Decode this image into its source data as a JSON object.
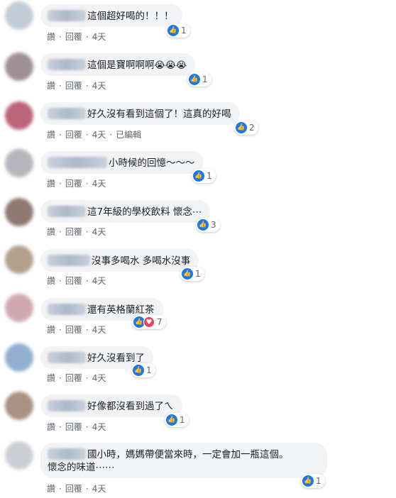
{
  "actions": {
    "like": "讚",
    "reply": "回覆",
    "separator": "·"
  },
  "comments": [
    {
      "text": "這個超好喝的！！！",
      "time": "4天",
      "reactions": "1"
    },
    {
      "text": "這個是寶啊啊啊",
      "emoji": "😭😭😭",
      "time": "4天",
      "reactions": "1"
    },
    {
      "text": "好久沒有看到這個了！這真的好喝",
      "time": "4天",
      "edited": "已編輯",
      "reactions": "2"
    },
    {
      "text": "小時候的回憶〜〜〜",
      "time": "4天",
      "reactions": "1"
    },
    {
      "text": "這7年級的學校飲料 懷念⋯",
      "time": "4天",
      "reactions": "3"
    },
    {
      "text": "沒事多喝水 多喝水沒事",
      "time": "4天",
      "reactions": "1"
    },
    {
      "text": "還有英格蘭紅茶",
      "time": "4天",
      "reactions": "7"
    },
    {
      "text": "好久沒看到了",
      "time": "4天",
      "reactions": "1"
    },
    {
      "text": "好像都沒看到過了ㄟ",
      "time": "4天",
      "reactions": "1"
    },
    {
      "text_line1": "國小時，媽媽帶便當來時，一定會加一瓶這個。",
      "text_line2": "懷念的味道⋯⋯",
      "time": "4天",
      "reactions": "1"
    }
  ],
  "colors": {
    "like_blue": "#1877f2",
    "love_red": "#f33e58",
    "bubble_bg": "#f2f3f5"
  },
  "icons": {
    "like": "thumbs-up-icon",
    "love": "heart-icon"
  }
}
